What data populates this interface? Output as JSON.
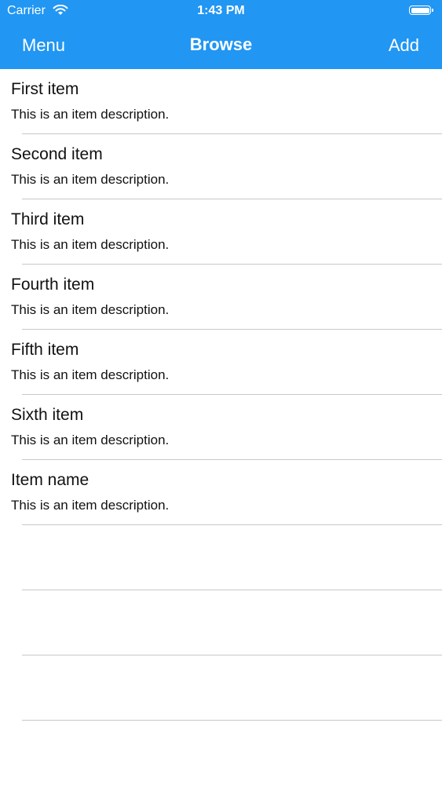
{
  "status_bar": {
    "carrier": "Carrier",
    "time": "1:43 PM"
  },
  "nav": {
    "left": "Menu",
    "title": "Browse",
    "right": "Add"
  },
  "items": [
    {
      "title": "First item",
      "description": "This is an item description."
    },
    {
      "title": "Second item",
      "description": "This is an item description."
    },
    {
      "title": "Third item",
      "description": "This is an item description."
    },
    {
      "title": "Fourth item",
      "description": "This is an item description."
    },
    {
      "title": "Fifth item",
      "description": "This is an item description."
    },
    {
      "title": "Sixth item",
      "description": "This is an item description."
    },
    {
      "title": "Item name",
      "description": "This is an item description."
    }
  ],
  "colors": {
    "header_bg": "#2196f3",
    "separator": "#c8c8c8"
  }
}
